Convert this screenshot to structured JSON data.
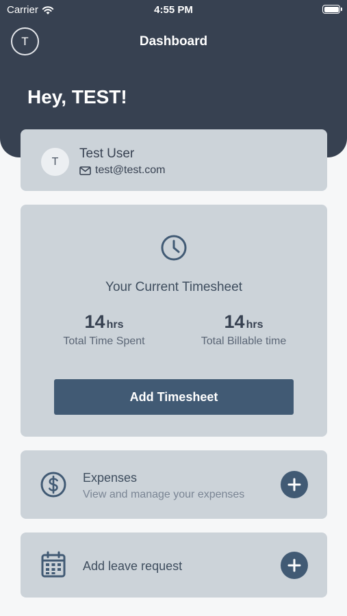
{
  "status_bar": {
    "carrier": "Carrier",
    "time": "4:55 PM"
  },
  "header": {
    "avatar_initial": "T",
    "title": "Dashboard",
    "greeting": "Hey, TEST!"
  },
  "user": {
    "initial": "T",
    "name": "Test User",
    "email": "test@test.com"
  },
  "timesheet": {
    "title": "Your Current Timesheet",
    "stats": [
      {
        "value": "14",
        "unit": "hrs",
        "label": "Total Time Spent"
      },
      {
        "value": "14",
        "unit": "hrs",
        "label": "Total Billable time"
      }
    ],
    "button_label": "Add Timesheet"
  },
  "expenses": {
    "title": "Expenses",
    "subtitle": "View and manage your expenses"
  },
  "leave": {
    "title": "Add leave request"
  },
  "colors": {
    "header_bg": "#374151",
    "card_bg": "#ccd3d9",
    "accent": "#415a74"
  }
}
